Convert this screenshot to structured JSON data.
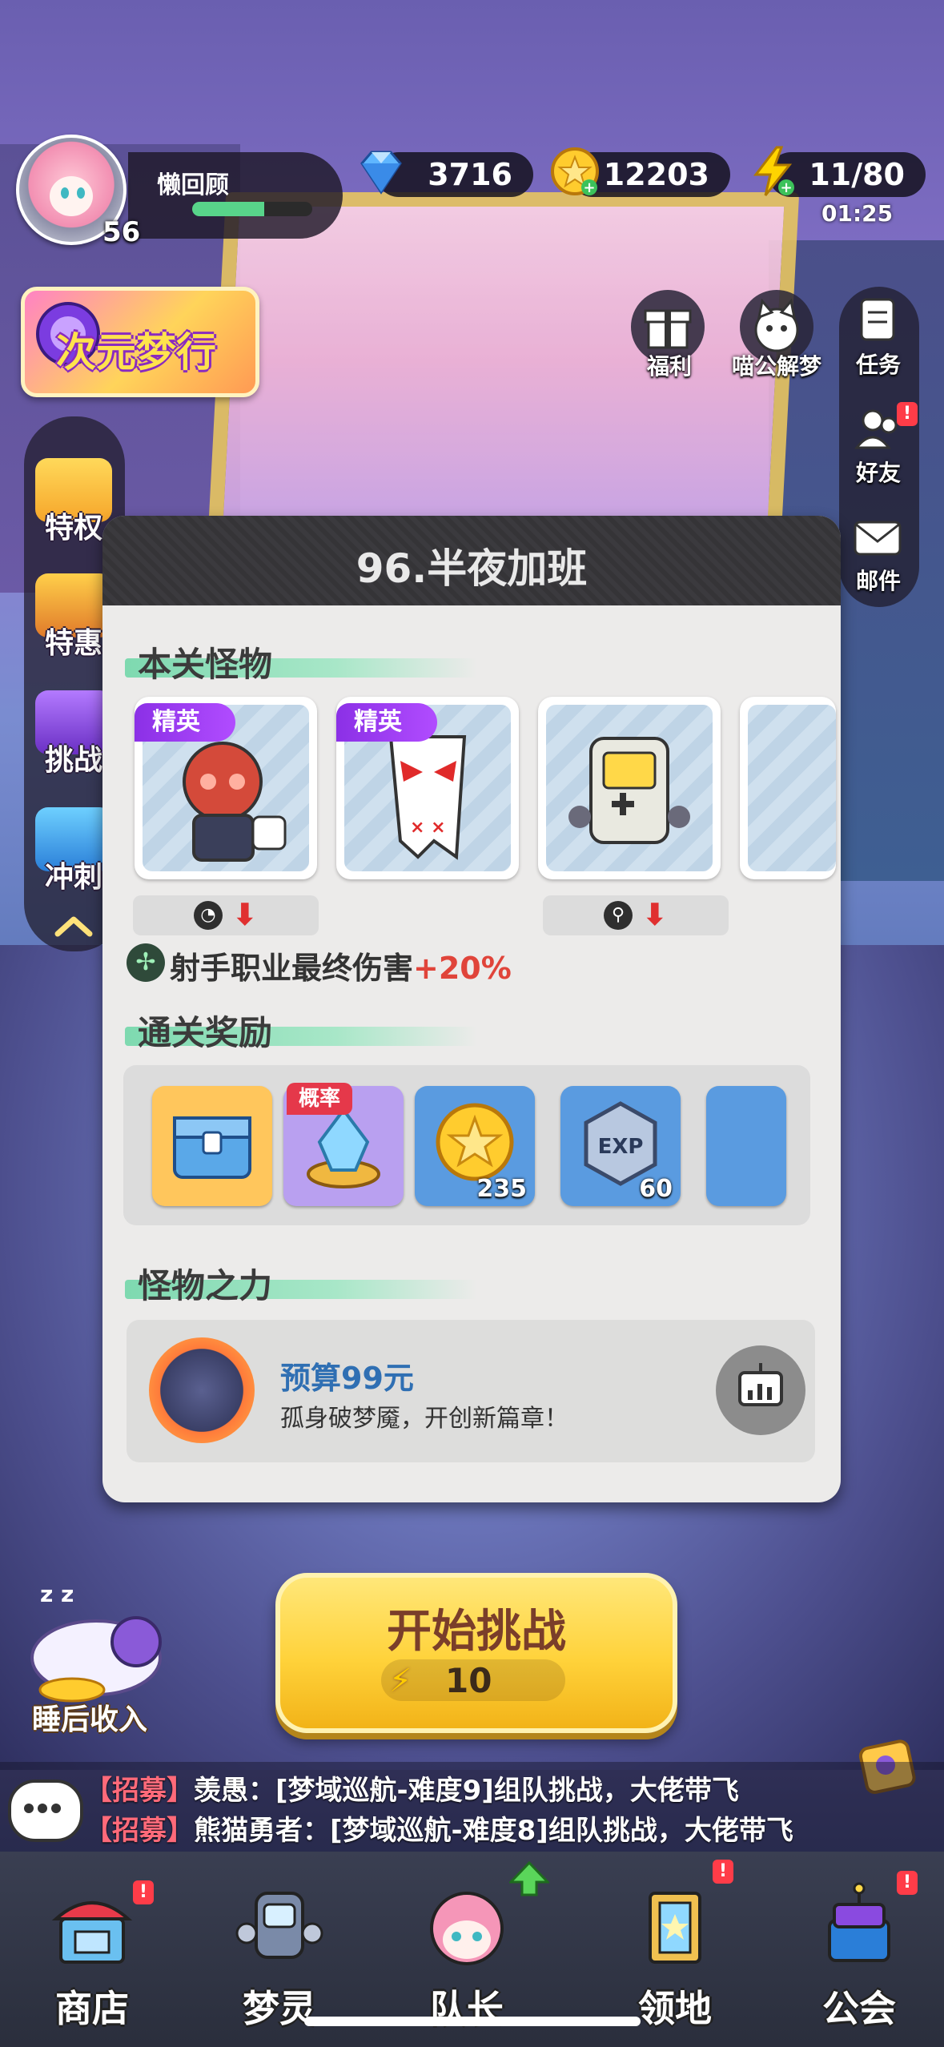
{
  "player": {
    "name": "懒回顾",
    "level": "56",
    "exp_fraction": 0.6
  },
  "resources": {
    "diamonds": "3716",
    "coins": "12203",
    "stamina": "11/80",
    "stamina_timer": "01:25"
  },
  "event_banner": {
    "title": "次元梦行"
  },
  "top_buttons": [
    {
      "label": "福利",
      "icon": "gift-icon"
    },
    {
      "label": "喵公解梦",
      "icon": "cat-icon"
    }
  ],
  "right_menu": [
    {
      "label": "任务",
      "icon": "task-icon"
    },
    {
      "label": "好友",
      "icon": "friends-icon",
      "badge": "!"
    },
    {
      "label": "邮件",
      "icon": "mail-icon"
    }
  ],
  "left_menu": [
    {
      "label": "特权",
      "icon": "privilege-icon"
    },
    {
      "label": "特惠",
      "icon": "gift-box-icon"
    },
    {
      "label": "挑战",
      "icon": "challenge-icon"
    },
    {
      "label": "冲刺",
      "icon": "sprint-icon"
    }
  ],
  "dialog": {
    "title": "96.半夜加班",
    "monsters_header": "本关怪物",
    "monsters": [
      {
        "tag": "精英",
        "name": "office-monster"
      },
      {
        "tag": "精英",
        "name": "paper-monster"
      },
      {
        "tag": "",
        "name": "gameboy-monster"
      }
    ],
    "bonus_label": "射手职业最终伤害",
    "bonus_value": "+20%",
    "rewards_header": "通关奖励",
    "rewards": [
      {
        "icon": "chest-icon",
        "count": ""
      },
      {
        "icon": "crystal-icon",
        "count": "",
        "tag": "概率"
      },
      {
        "icon": "coin-icon",
        "count": "235"
      },
      {
        "icon": "exp-icon",
        "count": "60"
      }
    ],
    "power_header": "怪物之力",
    "power_title": "预算99元",
    "power_desc": "孤身破梦魇，开创新篇章！"
  },
  "start_button": {
    "label": "开始挑战",
    "cost": "10"
  },
  "sleep_income": {
    "label": "睡后收入"
  },
  "chat": [
    {
      "tag": "【招募】",
      "text": "羡愚：[梦域巡航-难度9]组队挑战，大佬带飞"
    },
    {
      "tag": "【招募】",
      "text": "熊猫勇者：[梦域巡航-难度8]组队挑战，大佬带飞"
    }
  ],
  "nav": [
    {
      "label": "商店",
      "icon": "shop-icon",
      "badge": "!"
    },
    {
      "label": "梦灵",
      "icon": "spirit-icon"
    },
    {
      "label": "队长",
      "icon": "captain-icon"
    },
    {
      "label": "领地",
      "icon": "territory-icon",
      "badge": "!"
    },
    {
      "label": "公会",
      "icon": "guild-icon",
      "badge": "!"
    }
  ],
  "colors": {
    "accent_green": "#7ed9b0",
    "elite_purple": "#9b3cf0",
    "start_yellow": "#ffd23a",
    "bonus_red": "#e0443a"
  }
}
